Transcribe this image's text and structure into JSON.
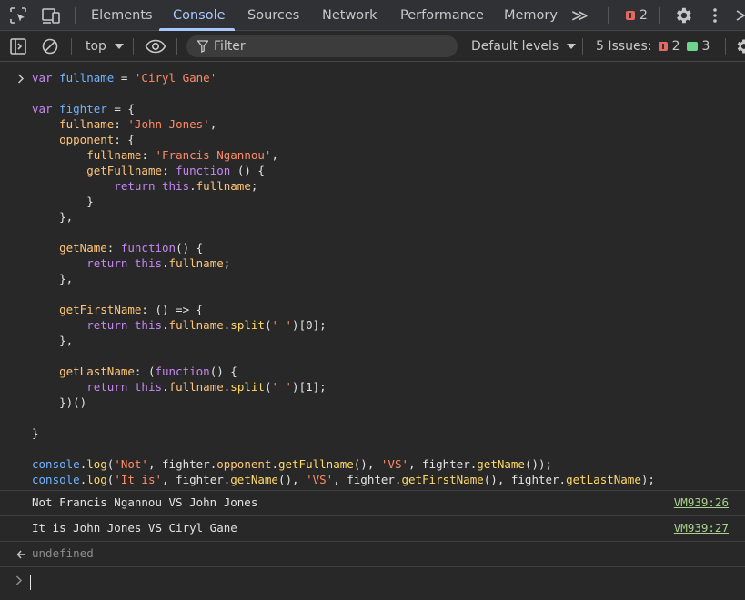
{
  "tabbar": {
    "tabs": [
      {
        "label": "Elements"
      },
      {
        "label": "Console"
      },
      {
        "label": "Sources"
      },
      {
        "label": "Network"
      },
      {
        "label": "Performance"
      },
      {
        "label": "Memory"
      }
    ],
    "active_tab": "Console",
    "more_label": "≫",
    "error_count": "2",
    "icons": [
      "inspect-element-icon",
      "device-toolbar-icon",
      "more-tabs-icon",
      "error-badge-icon",
      "gear-icon",
      "kebab-menu-icon",
      "close-icon"
    ]
  },
  "toolbar": {
    "context_label": "top",
    "filter_placeholder": "Filter",
    "levels_label": "Default levels",
    "issues_label": "5 Issues:",
    "issues_error_count": "2",
    "issues_info_count": "3"
  },
  "console": {
    "messages": [
      {
        "text": "Not Francis Ngannou VS John Jones",
        "source": "VM939:26"
      },
      {
        "text": "It is John Jones VS Ciryl Gane",
        "source": "VM939:27"
      }
    ],
    "result": "undefined"
  },
  "colors": {
    "background": "#282828",
    "active_tab": "#a8c7fa",
    "keyword": "#c586f2",
    "variable": "#6fb3ff",
    "property": "#ffc57a",
    "string": "#ff8a65",
    "link": "#a8d18d"
  }
}
